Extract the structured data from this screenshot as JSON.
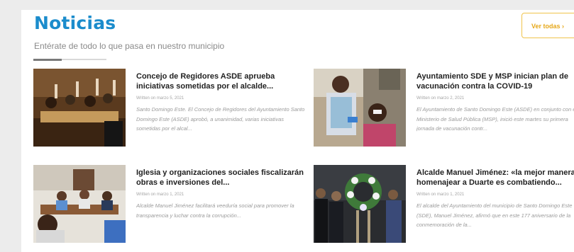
{
  "section": {
    "title": "Noticias",
    "subtitle": "Entérate de todo lo que pasa en nuestro municipio",
    "see_all_label": "Ver todas ›"
  },
  "articles": [
    {
      "title": "Concejo de Regidores ASDE aprueba iniciativas sometidas por el alcalde...",
      "date": "Written on marzo 5, 2021",
      "excerpt": "Santo Domingo Este. El Concejo de Regidores del Ayuntamiento Santo Domingo Este (ASDE) aprobó, a unanimidad, varias iniciativas sometidas por el alcal...",
      "image": "council-session-photo"
    },
    {
      "title": "Ayuntamiento SDE y MSP inician plan de vacunación contra la COVID-19",
      "date": "Written on marzo 2, 2021",
      "excerpt": "El Ayuntamiento de Santo Domingo Este (ASDE) en conjunto con el Ministerio de Salud Pública (MSP), inició este martes su primera jornada de vacunación contr...",
      "image": "vaccination-photo"
    },
    {
      "title": "Iglesia y organizaciones sociales fiscalizarán obras e inversiones del...",
      "date": "Written on marzo 1, 2021",
      "excerpt": "Alcalde Manuel Jiménez facilitará veeduría social para promover la transparencia y luchar contra la corrupción...",
      "image": "meeting-photo"
    },
    {
      "title": "Alcalde Manuel Jiménez: «la mejor manera de homenajear a Duarte es combatiendo...",
      "date": "Written on marzo 1, 2021",
      "excerpt": "El alcalde del Ayuntamiento del municipio de Santo Domingo Este (SDE), Manuel Jiménez, afirmó que en este 177 aniversario de la conmemoración de la...",
      "image": "wreath-ceremony-photo"
    }
  ]
}
